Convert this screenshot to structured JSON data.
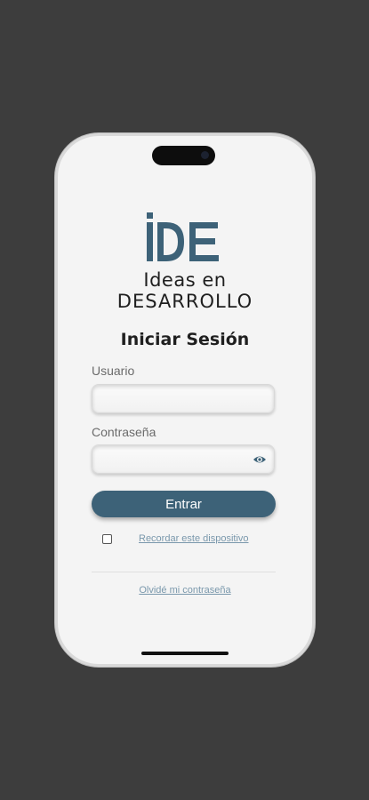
{
  "brand": {
    "logo_text": "iDE",
    "line1": "Ideas en",
    "line2": "DESARROLLO",
    "color": "#3d6278"
  },
  "login": {
    "title": "Iniciar Sesión",
    "username_label": "Usuario",
    "username_value": "",
    "password_label": "Contraseña",
    "password_value": "",
    "submit_label": "Entrar",
    "remember_label": "Recordar este dispositivo",
    "remember_checked": false,
    "forgot_label": "Olvidé mi contraseña"
  },
  "icons": {
    "password_toggle": "eye-icon"
  },
  "colors": {
    "background": "#3d3d3d",
    "screen": "#f4f4f4",
    "accent": "#3d6278",
    "link": "#7a98ac"
  }
}
